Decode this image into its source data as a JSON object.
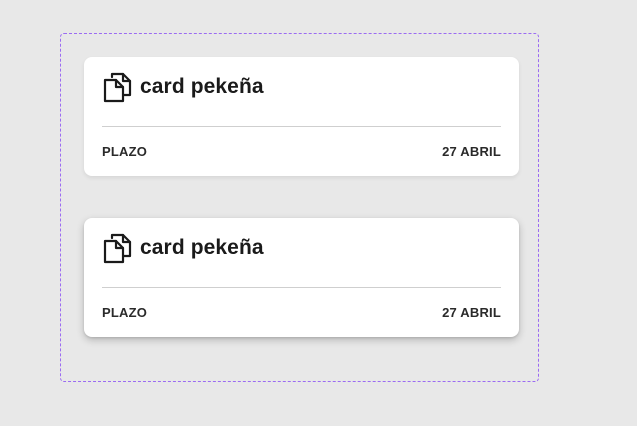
{
  "cards": [
    {
      "title": "card pekeña",
      "icon": "documents-icon",
      "meta_label": "PLAZO",
      "meta_value": "27 ABRIL"
    },
    {
      "title": "card pekeña",
      "icon": "documents-icon",
      "meta_label": "PLAZO",
      "meta_value": "27 ABRIL"
    }
  ],
  "colors": {
    "background": "#e8e8e8",
    "frame_border": "#9b6bf2",
    "card_bg": "#ffffff",
    "divider": "#cfcfcf",
    "text": "#1a1a1a"
  }
}
